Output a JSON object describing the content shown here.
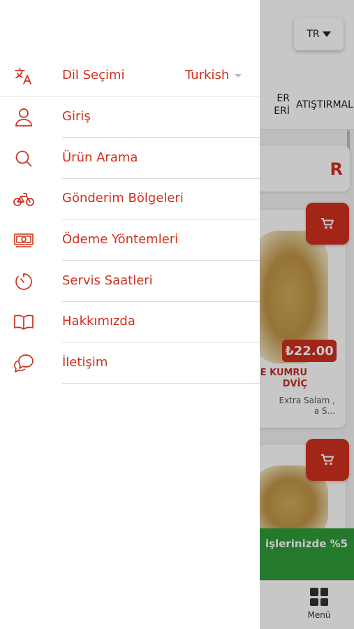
{
  "drawer": {
    "language": {
      "label": "Dil Seçimi",
      "value": "Turkish",
      "icon": "translate-icon"
    },
    "items": [
      {
        "label": "Giriş",
        "icon": "user-icon"
      },
      {
        "label": "Ürün Arama",
        "icon": "search-icon"
      },
      {
        "label": "Gönderim Bölgeleri",
        "icon": "bicycle-icon"
      },
      {
        "label": "Ödeme Yöntemleri",
        "icon": "money-icon"
      },
      {
        "label": "Servis Saatleri",
        "icon": "timer-icon"
      },
      {
        "label": "Hakkımızda",
        "icon": "book-icon"
      },
      {
        "label": "İletişim",
        "icon": "chat-icon"
      }
    ]
  },
  "background": {
    "lang_button": "TR",
    "tabs": [
      "ER\nERİ",
      "ATIŞTIRMAL"
    ],
    "section_title": "R",
    "product": {
      "price": "₺22.00",
      "name": "E KUMRU\nDVİÇ",
      "desc": "Extra Salam ,\na S..."
    },
    "promo": "işlerinizde %5",
    "menu_label": "Menü"
  },
  "colors": {
    "accent": "#d0301f",
    "promo": "#2f9b3a"
  }
}
